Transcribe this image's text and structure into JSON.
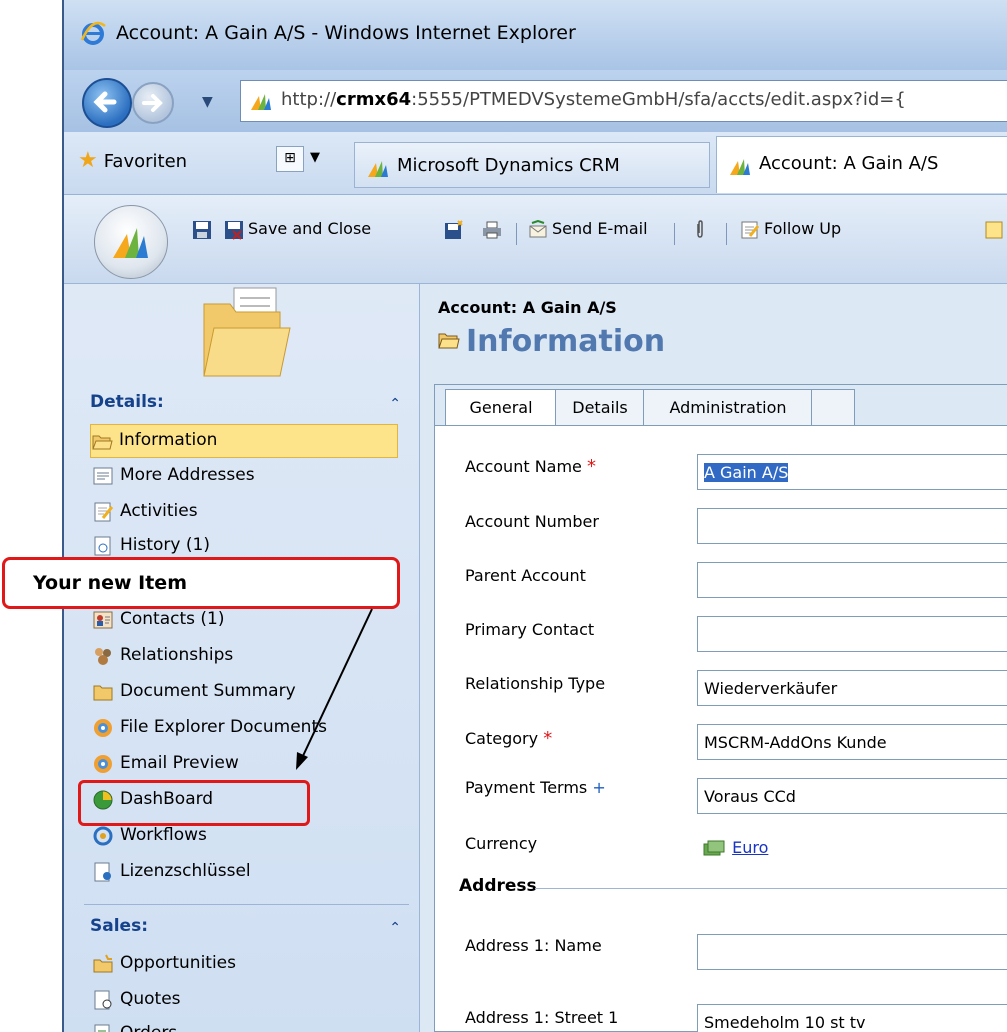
{
  "window": {
    "title": "Account: A Gain A/S - Windows Internet Explorer"
  },
  "address_bar": {
    "url_prefix": "http://",
    "url_host": "crmx64",
    "url_rest": ":5555/PTMEDVSystemeGmbH/sfa/accts/edit.aspx?id={"
  },
  "browser_tabs": {
    "favorites_label": "Favoriten",
    "tabs": [
      {
        "label": "Microsoft Dynamics CRM"
      },
      {
        "label": "Account: A Gain A/S"
      }
    ]
  },
  "toolbar": {
    "save_close_label": "Save and Close",
    "send_email_label": "Send E-mail",
    "follow_up_label": "Follow Up"
  },
  "nav": {
    "details_header": "Details:",
    "items": [
      {
        "label": "Information",
        "icon": "information-icon"
      },
      {
        "label": "More Addresses",
        "icon": "addresses-icon"
      },
      {
        "label": "Activities",
        "icon": "activities-icon"
      },
      {
        "label": "History (1)",
        "icon": "history-icon"
      },
      {
        "label": "Contacts (1)",
        "icon": "contacts-icon"
      },
      {
        "label": "Relationships",
        "icon": "relationships-icon"
      },
      {
        "label": "Document Summary",
        "icon": "document-summary-icon"
      },
      {
        "label": "File Explorer Documents",
        "icon": "file-explorer-icon"
      },
      {
        "label": "Email Preview",
        "icon": "email-preview-icon"
      },
      {
        "label": "DashBoard",
        "icon": "dashboard-icon"
      },
      {
        "label": "Workflows",
        "icon": "workflows-icon"
      },
      {
        "label": "Lizenzschlüssel",
        "icon": "license-key-icon"
      }
    ],
    "sales_header": "Sales:",
    "sales_items": [
      {
        "label": "Opportunities",
        "icon": "opportunities-icon"
      },
      {
        "label": "Quotes",
        "icon": "quotes-icon"
      },
      {
        "label": "Orders",
        "icon": "orders-icon"
      }
    ]
  },
  "form": {
    "entity_header": "Account: A Gain A/S",
    "section_title": "Information",
    "tabs": [
      "General",
      "Details",
      "Administration"
    ],
    "fields": [
      {
        "label": "Account Name",
        "value": "A Gain A/S",
        "marker": "*"
      },
      {
        "label": "Account Number",
        "value": ""
      },
      {
        "label": "Parent Account",
        "value": ""
      },
      {
        "label": "Primary Contact",
        "value": ""
      },
      {
        "label": "Relationship Type",
        "value": "Wiederverkäufer"
      },
      {
        "label": "Category",
        "value": "MSCRM-AddOns Kunde",
        "marker": "*"
      },
      {
        "label": "Payment Terms",
        "value": "Voraus CCd",
        "marker": "+"
      },
      {
        "label": "Currency",
        "value": "Euro"
      }
    ],
    "address_header": "Address",
    "address_fields": [
      {
        "label": "Address 1: Name",
        "value": ""
      },
      {
        "label": "Address 1: Street 1",
        "value": "Smedeholm 10 st tv"
      }
    ]
  },
  "annotation": {
    "callout_text": "Your new Item",
    "accent": "#e01818"
  }
}
